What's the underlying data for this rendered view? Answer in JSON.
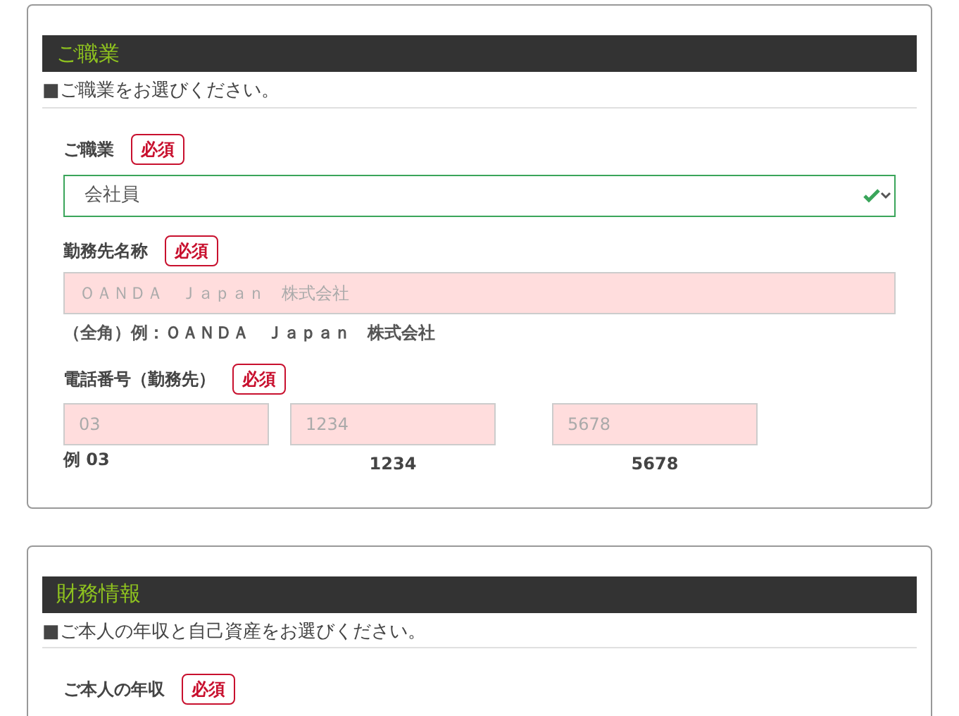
{
  "sections": [
    {
      "title": "ご職業",
      "intro": "■ご職業をお選びください。",
      "fields": [
        {
          "kind": "select",
          "label": "ご職業",
          "required": "必須",
          "value": "会社員",
          "valid": true
        },
        {
          "kind": "text",
          "label": "勤務先名称",
          "required": "必須",
          "placeholder": "ＯＡＮＤＡ　Ｊａｐａｎ　株式会社",
          "note": "（全角）例：ＯＡＮＤＡ　Ｊａｐａｎ　株式会社"
        },
        {
          "kind": "phone",
          "label": "電話番号（勤務先）",
          "required": "必須",
          "parts": [
            {
              "placeholder": "03",
              "hint": "例 03"
            },
            {
              "placeholder": "1234",
              "hint": "1234"
            },
            {
              "placeholder": "5678",
              "hint": "5678"
            }
          ]
        }
      ]
    },
    {
      "title": "財務情報",
      "intro": "■ご本人の年収と自己資産をお選びください。",
      "fields": [
        {
          "kind": "label",
          "label": "ご本人の年収",
          "required": "必須"
        }
      ]
    }
  ]
}
